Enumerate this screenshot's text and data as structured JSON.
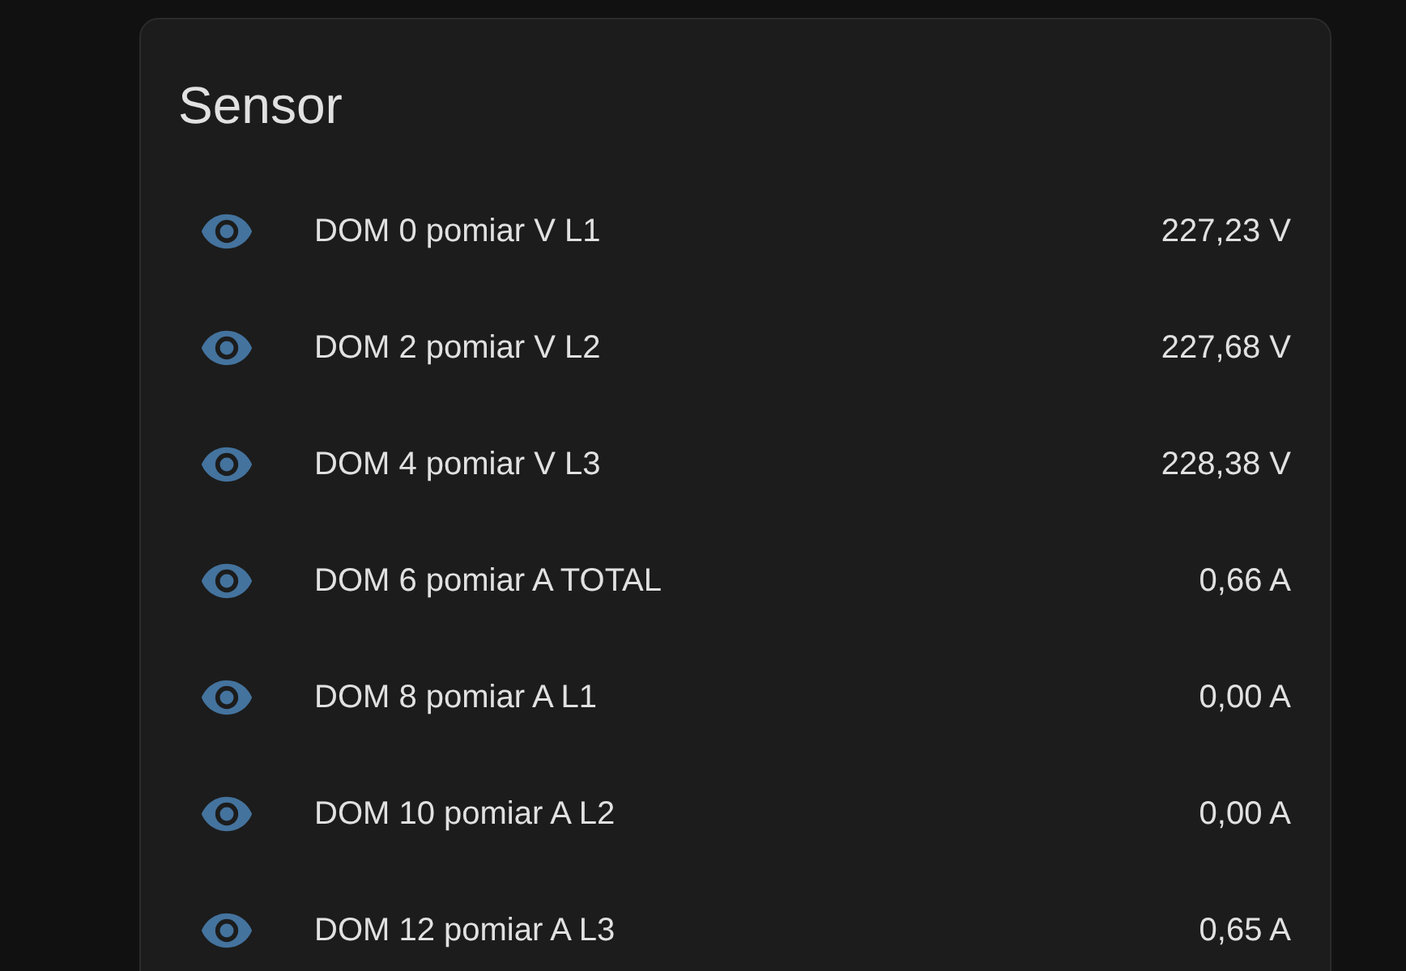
{
  "card": {
    "title": "Sensor",
    "rows": [
      {
        "name": "DOM 0 pomiar V L1",
        "value": "227,23 V"
      },
      {
        "name": "DOM 2 pomiar V L2",
        "value": "227,68 V"
      },
      {
        "name": "DOM 4 pomiar V L3",
        "value": "228,38 V"
      },
      {
        "name": "DOM 6 pomiar A TOTAL",
        "value": "0,66 A"
      },
      {
        "name": "DOM 8 pomiar A L1",
        "value": "0,00 A"
      },
      {
        "name": "DOM 10 pomiar A L2",
        "value": "0,00 A"
      },
      {
        "name": "DOM 12 pomiar A L3",
        "value": "0,65 A"
      }
    ]
  }
}
